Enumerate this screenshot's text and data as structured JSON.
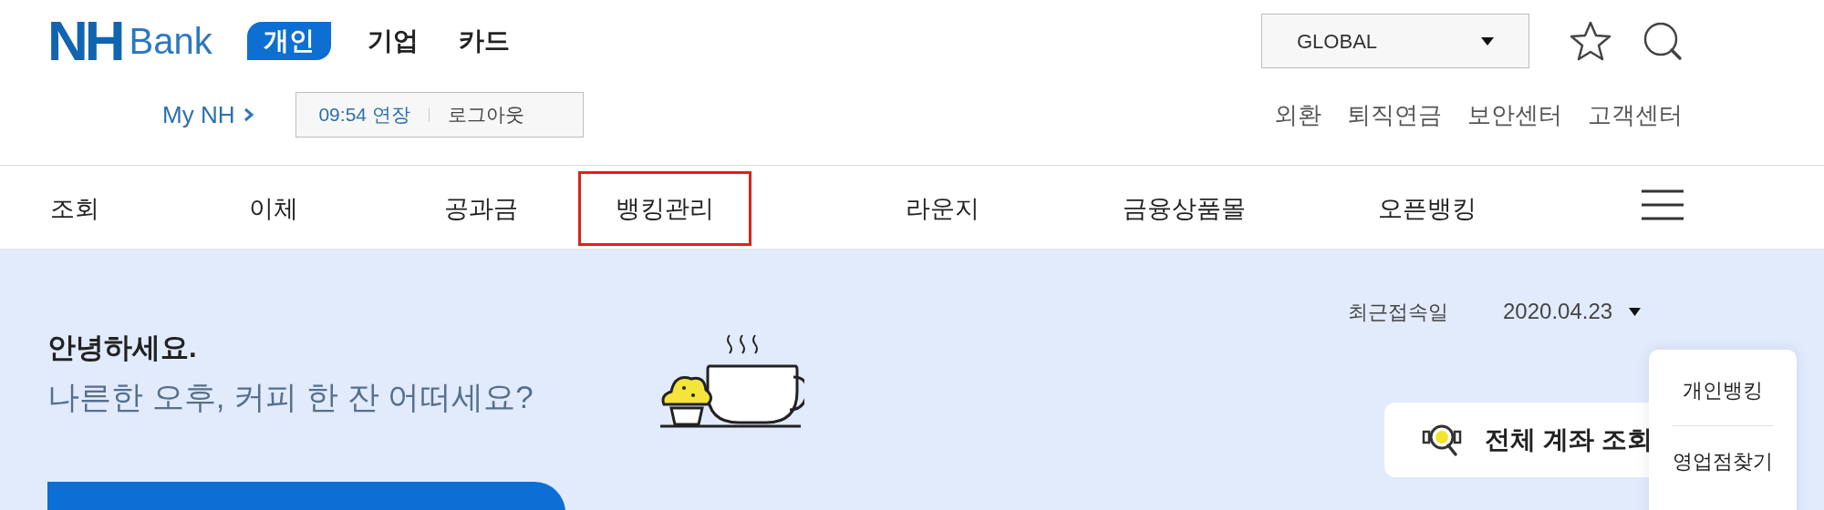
{
  "logo": {
    "mark": "NH",
    "name": "Bank"
  },
  "segments": [
    {
      "label": "개인",
      "selected": true
    },
    {
      "label": "기업",
      "selected": false
    },
    {
      "label": "카드",
      "selected": false
    }
  ],
  "language_select": {
    "value": "GLOBAL"
  },
  "my_link": "My NH",
  "session": {
    "timer": "09:54 연장",
    "logout": "로그아웃"
  },
  "utility_links": [
    "외환",
    "퇴직연금",
    "보안센터",
    "고객센터"
  ],
  "nav": [
    {
      "label": "조회",
      "highlighted": false
    },
    {
      "label": "이체",
      "highlighted": false
    },
    {
      "label": "공과금",
      "highlighted": false
    },
    {
      "label": "뱅킹관리",
      "highlighted": true
    },
    {
      "label": "라운지",
      "highlighted": false
    },
    {
      "label": "금융상품몰",
      "highlighted": false
    },
    {
      "label": "오픈뱅킹",
      "highlighted": false
    }
  ],
  "last_login": {
    "label": "최근접속일",
    "date": "2020.04.23"
  },
  "greeting": {
    "hello": "안녕하세요.",
    "message": "나른한 오후, 커피 한 잔 어떠세요?"
  },
  "account_button": "전체 계좌 조회",
  "quick_menu": [
    "개인뱅킹",
    "영업점찾기"
  ]
}
